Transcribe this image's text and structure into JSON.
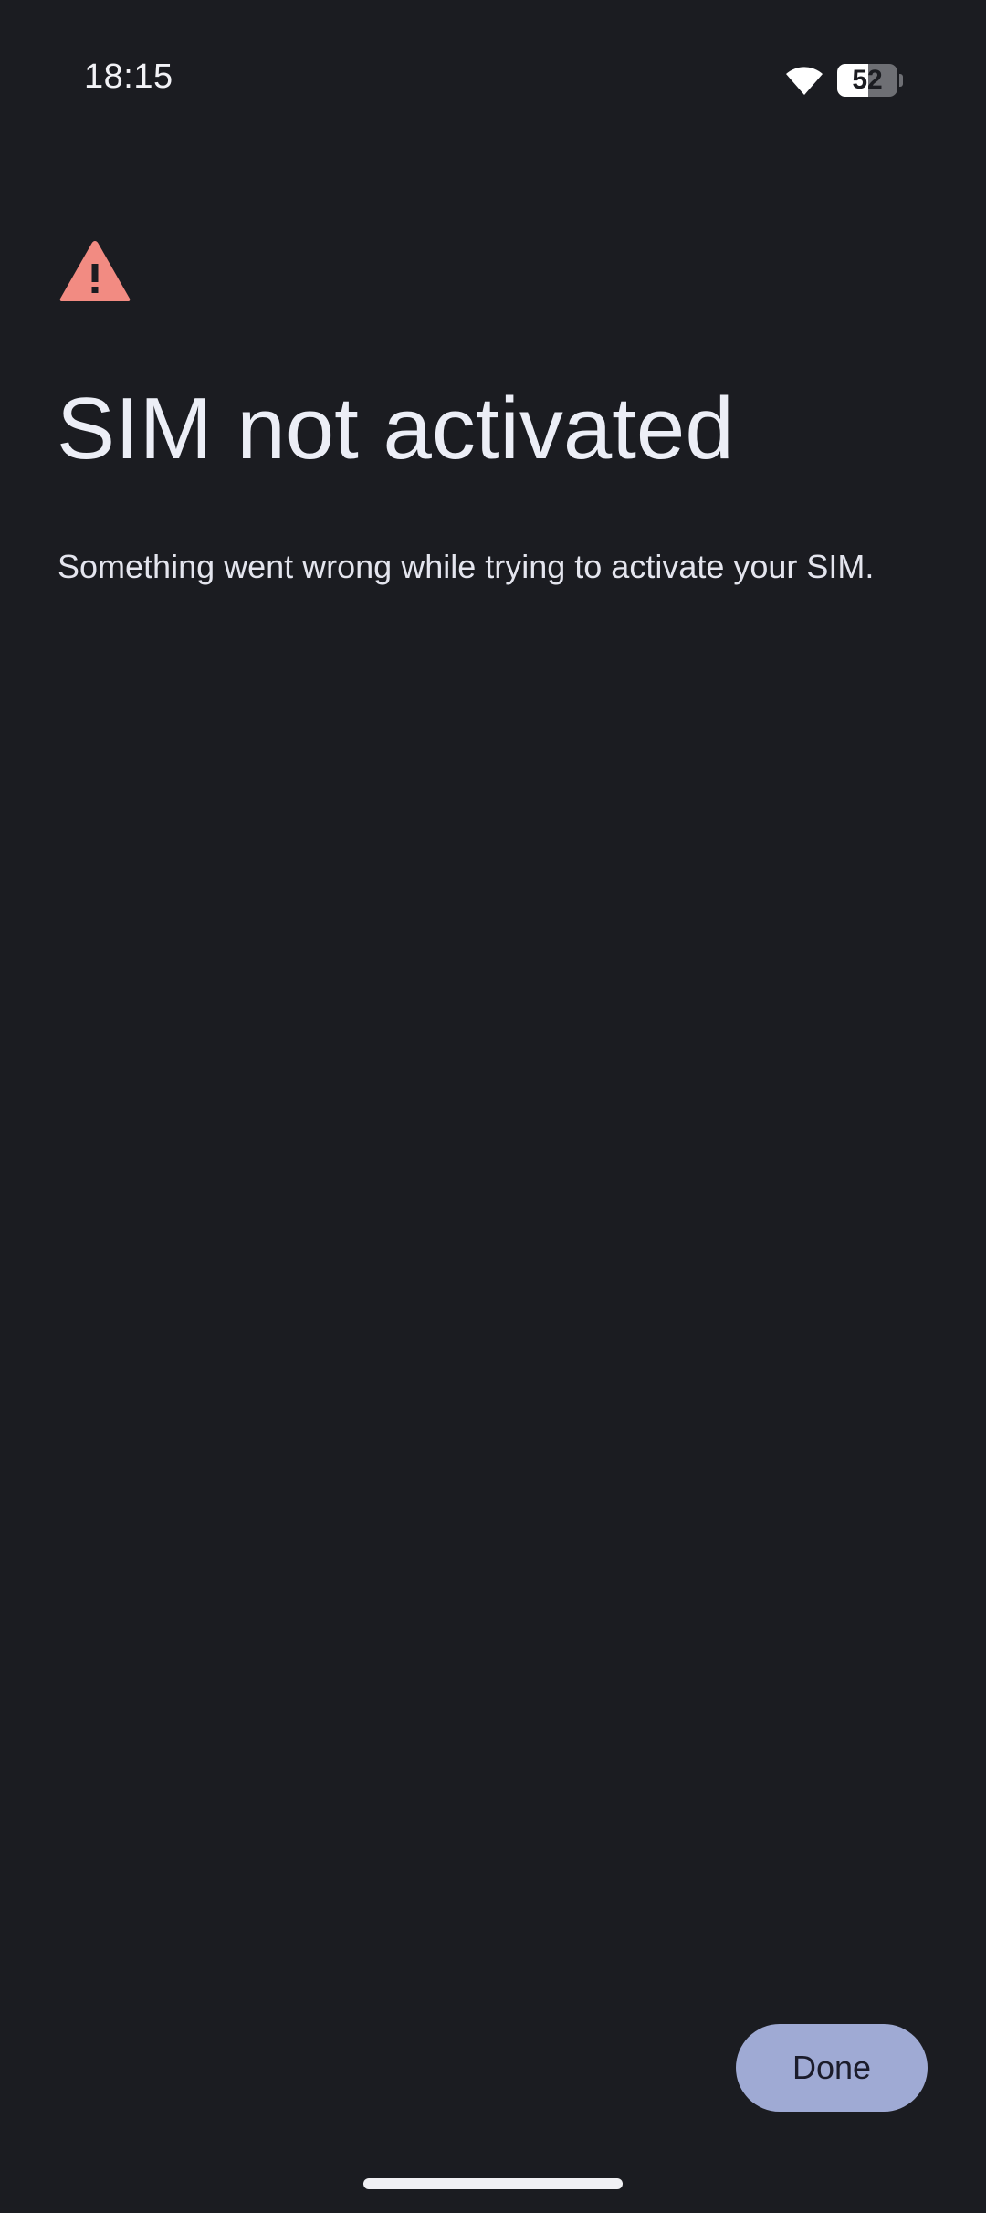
{
  "status_bar": {
    "time": "18:15",
    "battery_level": "52",
    "battery_fraction": 0.52,
    "icons": [
      "wifi-icon",
      "battery-icon"
    ]
  },
  "warning": {
    "icon": "warning-triangle-icon",
    "color": "#f28b82"
  },
  "page": {
    "title": "SIM not activated",
    "message": "Something went wrong while trying to activate your SIM."
  },
  "actions": {
    "done_label": "Done",
    "done_color": "#9faad4"
  },
  "colors": {
    "background": "#1b1c21",
    "text": "#eceef6"
  }
}
